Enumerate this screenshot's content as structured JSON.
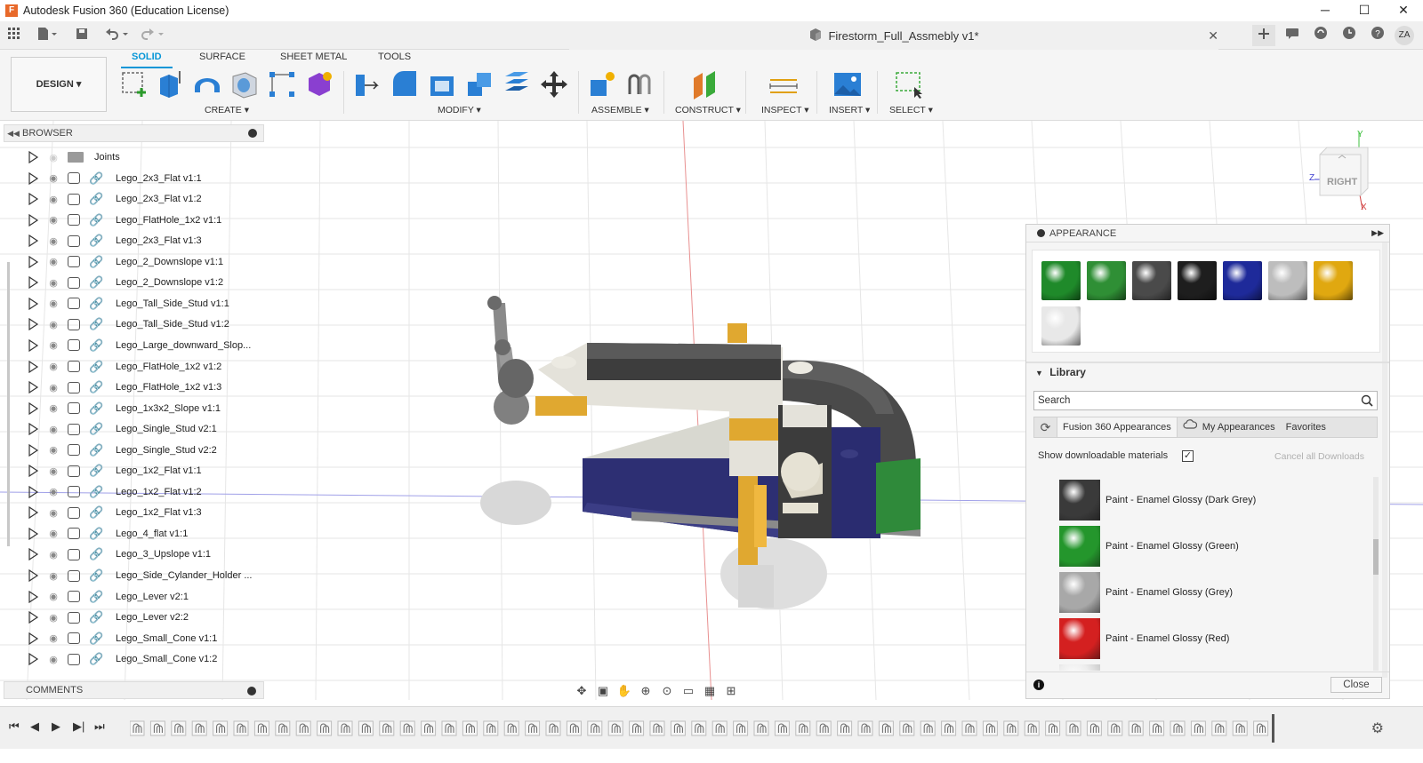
{
  "window": {
    "title": "Autodesk Fusion 360 (Education License)",
    "logo_letter": "F",
    "controls": [
      "─",
      "☐",
      "✕"
    ]
  },
  "quick_access": {
    "document_title": "Firestorm_Full_Assmebly v1*",
    "doc_close": "✕",
    "avatar": "ZA"
  },
  "ribbon": {
    "workspace": "DESIGN ▾",
    "tabs": [
      "SOLID",
      "SURFACE",
      "SHEET METAL",
      "TOOLS"
    ],
    "active_tab": "SOLID",
    "groups": [
      "CREATE ▾",
      "MODIFY ▾",
      "ASSEMBLE ▾",
      "CONSTRUCT ▾",
      "INSPECT ▾",
      "INSERT ▾",
      "SELECT ▾"
    ]
  },
  "browser": {
    "title": "BROWSER",
    "items": [
      {
        "label": "Joints",
        "type": "folder"
      },
      {
        "label": "Lego_2x3_Flat v1:1",
        "type": "component"
      },
      {
        "label": "Lego_2x3_Flat v1:2",
        "type": "component"
      },
      {
        "label": "Lego_FlatHole_1x2 v1:1",
        "type": "component"
      },
      {
        "label": "Lego_2x3_Flat v1:3",
        "type": "component"
      },
      {
        "label": "Lego_2_Downslope v1:1",
        "type": "component"
      },
      {
        "label": "Lego_2_Downslope v1:2",
        "type": "component"
      },
      {
        "label": "Lego_Tall_Side_Stud v1:1",
        "type": "component"
      },
      {
        "label": "Lego_Tall_Side_Stud v1:2",
        "type": "component"
      },
      {
        "label": "Lego_Large_downward_Slop...",
        "type": "component"
      },
      {
        "label": "Lego_FlatHole_1x2 v1:2",
        "type": "component"
      },
      {
        "label": "Lego_FlatHole_1x2 v1:3",
        "type": "component"
      },
      {
        "label": "Lego_1x3x2_Slope v1:1",
        "type": "component"
      },
      {
        "label": "Lego_Single_Stud v2:1",
        "type": "component"
      },
      {
        "label": "Lego_Single_Stud v2:2",
        "type": "component"
      },
      {
        "label": "Lego_1x2_Flat v1:1",
        "type": "component"
      },
      {
        "label": "Lego_1x2_Flat v1:2",
        "type": "component"
      },
      {
        "label": "Lego_1x2_Flat v1:3",
        "type": "component"
      },
      {
        "label": "Lego_4_flat v1:1",
        "type": "component"
      },
      {
        "label": "Lego_3_Upslope v1:1",
        "type": "component"
      },
      {
        "label": "Lego_Side_Cylander_Holder ...",
        "type": "component"
      },
      {
        "label": "Lego_Lever v2:1",
        "type": "component"
      },
      {
        "label": "Lego_Lever v2:2",
        "type": "component"
      },
      {
        "label": "Lego_Small_Cone v1:1",
        "type": "component"
      },
      {
        "label": "Lego_Small_Cone v1:2",
        "type": "component"
      }
    ]
  },
  "comments": {
    "title": "COMMENTS"
  },
  "viewcube": {
    "face": "RIGHT",
    "axis_y": "Y",
    "axis_z": "Z",
    "axis_x": "X"
  },
  "appearance": {
    "title": "APPEARANCE",
    "in_design_swatches": [
      "#1f8a2a",
      "#2f8f35",
      "#4a4a4a",
      "#1e1e1e",
      "#1e2a9a",
      "#bdbdbd",
      "#e0a810",
      "#e8e8e8"
    ],
    "library_label": "Library",
    "search_placeholder": "Search",
    "tabs": [
      "Fusion 360 Appearances",
      "My Appearances",
      "Favorites"
    ],
    "show_downloadable": "Show downloadable materials",
    "checkbox_mark": "✓",
    "cancel_downloads": "Cancel all Downloads",
    "materials": [
      {
        "label": "Paint - Enamel Glossy (Dark Grey)",
        "color": "#3a3a3a"
      },
      {
        "label": "Paint - Enamel Glossy (Green)",
        "color": "#24962c"
      },
      {
        "label": "Paint - Enamel Glossy (Grey)",
        "color": "#a8a8a8"
      },
      {
        "label": "Paint - Enamel Glossy (Red)",
        "color": "#d42020"
      }
    ],
    "info": "i",
    "close": "Close"
  },
  "colors": {
    "accent": "#0696d7",
    "grid": "#e3e3e3",
    "axis_red": "#e06060",
    "axis_blue": "#8080e0"
  }
}
